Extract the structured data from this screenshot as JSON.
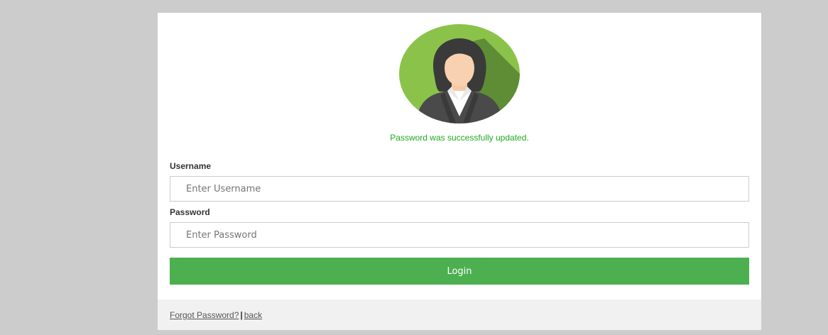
{
  "avatar": {
    "icon": "user-avatar-icon",
    "background_color": "#8bc34a"
  },
  "message": {
    "text": "Password was successfully updated.",
    "color": "#21a821"
  },
  "username": {
    "label": "Username",
    "placeholder": "Enter Username",
    "value": ""
  },
  "password": {
    "label": "Password",
    "placeholder": "Enter Password",
    "value": ""
  },
  "login_button": {
    "label": "Login",
    "color": "#4caf50"
  },
  "footer": {
    "forgot_label": "Forgot Password?",
    "separator": "|",
    "back_label": "back"
  }
}
